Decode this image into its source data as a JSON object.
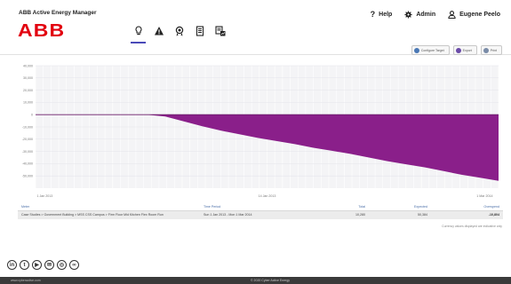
{
  "header": {
    "app_title": "ABB Active Energy Manager",
    "logo_text": "ABB",
    "nav": [
      {
        "icon": "lightbulb-icon"
      },
      {
        "icon": "warning-triangle-icon"
      },
      {
        "icon": "award-icon"
      },
      {
        "icon": "document-icon"
      },
      {
        "icon": "report-icon"
      }
    ],
    "help_label": "Help",
    "admin_label": "Admin",
    "user_label": "Eugene Peelo",
    "brand_color": "#e2000f",
    "accent_color": "#4a4ab8"
  },
  "toolbar": {
    "configure_label": "Configure Target",
    "export_label": "Export",
    "print_label": "Print"
  },
  "chart_data": {
    "type": "area",
    "ylim": [
      -60000,
      40000
    ],
    "y_ticks": [
      "40,000",
      "30,000",
      "20,000",
      "10,000",
      "0",
      "-10,000",
      "-20,000",
      "-30,000",
      "-40,000",
      "-50,000"
    ],
    "x_ticks": [
      "1 Jan 2013",
      "14 Jan 2013",
      "1 Mar 2014"
    ],
    "x": [
      0,
      0.04,
      0.08,
      0.12,
      0.16,
      0.2,
      0.24,
      0.28,
      0.32,
      0.36,
      0.4,
      0.44,
      0.48,
      0.52,
      0.56,
      0.6,
      0.64,
      0.68,
      0.72,
      0.76,
      0.8,
      0.84,
      0.88,
      0.92,
      0.96,
      1.0
    ],
    "series": [
      {
        "values": [
          0,
          0,
          0,
          0,
          0,
          0,
          0,
          -1500,
          -5500,
          -9500,
          -13000,
          -16000,
          -19000,
          -21500,
          -24000,
          -27000,
          -29500,
          -32000,
          -35000,
          -38000,
          -40500,
          -43000,
          -46000,
          -49000,
          -51500,
          -54000
        ],
        "color": "#8a1f8a"
      }
    ]
  },
  "table": {
    "headers": [
      "Meter",
      "Time Period",
      "Total",
      "Expected",
      "Overspend"
    ],
    "rows": [
      [
        "Case Studies > Government Building > MSS CSS Campus > Firm Floor Mid Kitchen Flex Room Run",
        "Sun 1 Jan 2013 - Mon 1 Mar 2014",
        "10,280",
        "50,384",
        "-10,804"
      ]
    ],
    "note": "Currency values displayed are indicative only"
  },
  "social": [
    {
      "icon": "linkedin-icon",
      "glyph": "in"
    },
    {
      "icon": "twitter-icon",
      "glyph": "t"
    },
    {
      "icon": "youtube-icon",
      "glyph": "▶"
    },
    {
      "icon": "email-icon",
      "glyph": "✉"
    },
    {
      "icon": "globe-icon",
      "glyph": "◎"
    },
    {
      "icon": "link-icon",
      "glyph": "∞"
    }
  ],
  "footer": {
    "left": "www.cyberactive.com",
    "center": "© 2020 Cyber Active Energy"
  }
}
